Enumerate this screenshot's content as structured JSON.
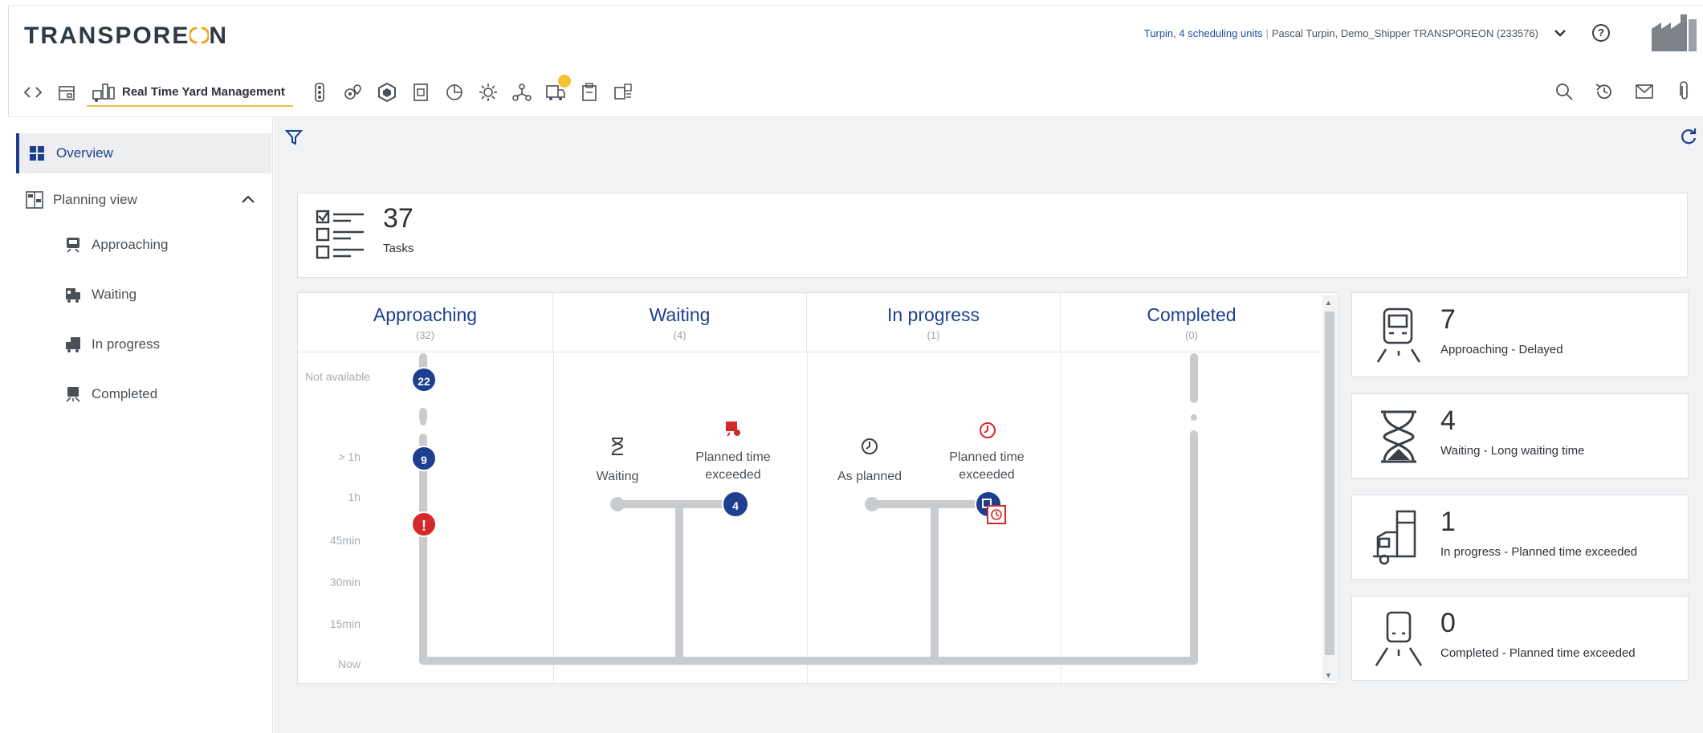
{
  "brand": {
    "name_left": "TRANSPORE",
    "name_right": "N"
  },
  "header": {
    "user_link": "Turpin, 4 scheduling units",
    "separator": "|",
    "user_detail": "Pascal Turpin, Demo_Shipper TRANSPOREON (233576)",
    "help": "?"
  },
  "toolbar": {
    "active_module": "Real Time Yard Management",
    "notification_color": "#f2c230",
    "active_underline_color": "#e8c24a"
  },
  "sidebar": {
    "overview": "Overview",
    "planning_view": "Planning view",
    "items": [
      {
        "label": "Approaching"
      },
      {
        "label": "Waiting"
      },
      {
        "label": "In progress"
      },
      {
        "label": "Completed"
      }
    ]
  },
  "tasks": {
    "count": "37",
    "label": "Tasks"
  },
  "flow": {
    "columns": [
      {
        "title": "Approaching",
        "count": "(32)"
      },
      {
        "title": "Waiting",
        "count": "(4)"
      },
      {
        "title": "In progress",
        "count": "(1)"
      },
      {
        "title": "Completed",
        "count": "(0)"
      }
    ],
    "time_axis": [
      "Not available",
      "> 1h",
      "1h",
      "45min",
      "30min",
      "15min",
      "Now"
    ],
    "approaching_badges": [
      "22",
      "9",
      "!"
    ],
    "waiting": {
      "ok_label": "Waiting",
      "late_label": "Planned time exceeded",
      "late_count": "4"
    },
    "in_progress": {
      "ok_label": "As planned",
      "late_label": "Planned time exceeded"
    },
    "colors": {
      "accent": "#1e3f8f",
      "alert": "#d6282b",
      "track": "#c9cccf"
    }
  },
  "kpis": [
    {
      "value": "7",
      "label": "Approaching - Delayed",
      "icon": "truck-front-icon"
    },
    {
      "value": "4",
      "label": "Waiting - Long waiting time",
      "icon": "hourglass-icon"
    },
    {
      "value": "1",
      "label": "In progress - Planned time exceeded",
      "icon": "truck-unloading-icon"
    },
    {
      "value": "0",
      "label": "Completed - Planned time exceeded",
      "icon": "truck-departing-icon"
    }
  ]
}
